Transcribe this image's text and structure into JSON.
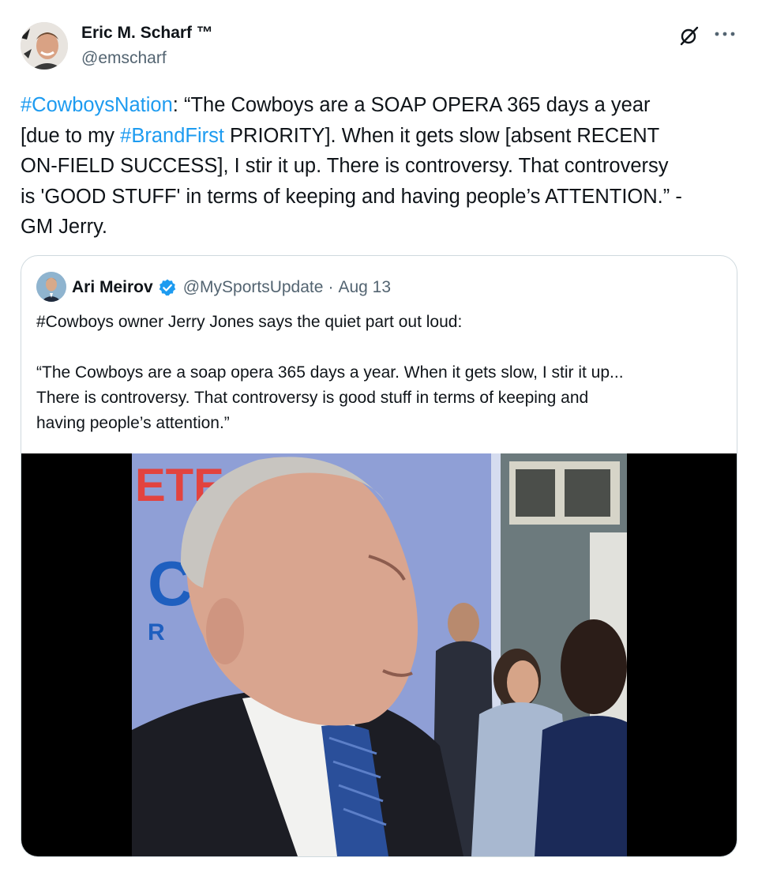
{
  "author": {
    "name": "Eric M. Scharf ™",
    "handle": "@emscharf"
  },
  "actions": {
    "grok_icon": "grok-icon",
    "more_label": "···"
  },
  "tweet_text": {
    "line1": {
      "hashtag": "#CowboysNation",
      "rest": ": “The Cowboys are a SOAP OPERA 365 days a year"
    },
    "line2": {
      "pre": "[due to my ",
      "hashtag": "#BrandFirst",
      "rest": " PRIORITY]. When it gets slow [absent RECENT"
    },
    "line3": "ON-FIELD SUCCESS], I stir it up. There is controversy. That controversy",
    "line4": "is 'GOOD STUFF' in terms of keeping and having people’s ATTENTION.” -",
    "line5": "GM Jerry."
  },
  "quote": {
    "name": "Ari Meirov",
    "handle": "@MySportsUpdate",
    "separator": "·",
    "date": "Aug 13",
    "line1": "#Cowboys owner Jerry Jones says the quiet part out loud:",
    "line2": "“The Cowboys are a soap opera 365 days a year. When it gets slow, I stir it up...",
    "line3": "There is controversy. That controversy is good stuff in terms of keeping and",
    "line4": "having people’s attention.”"
  },
  "media": {
    "type": "video",
    "backdrop_text": [
      "ETE",
      "C",
      "R"
    ]
  },
  "colors": {
    "link": "#1d9bf0",
    "secondary_text": "#536471",
    "border": "#cfd9de",
    "verified": "#1d9bf0"
  }
}
